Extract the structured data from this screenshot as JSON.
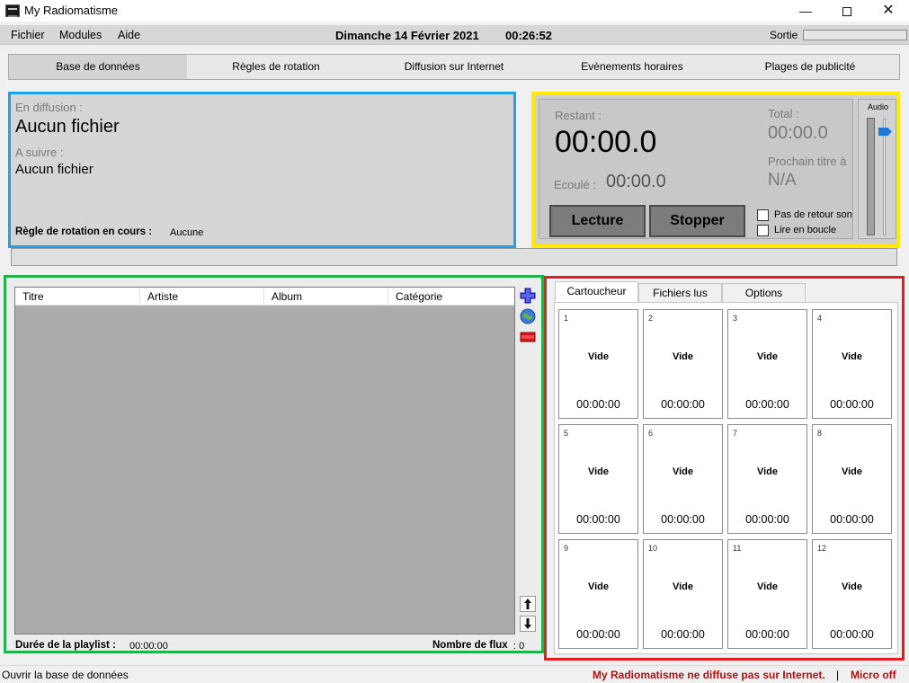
{
  "window": {
    "title": "My Radiomatisme",
    "controls": {
      "minimize": "—",
      "close": "✕"
    }
  },
  "menu": {
    "items": [
      "Fichier",
      "Modules",
      "Aide"
    ],
    "date": "Dimanche 14 Février 2021",
    "time": "00:26:52",
    "sortie_label": "Sortie"
  },
  "tabs": [
    "Base de données",
    "Règles de rotation",
    "Diffusion sur Internet",
    "Evènements horaires",
    "Plages de publicité"
  ],
  "now_playing": {
    "on_air_label": "En diffusion :",
    "on_air_value": "Aucun fichier",
    "next_label": "A suivre :",
    "next_value": "Aucun fichier",
    "rule_label": "Règle de rotation en cours :",
    "rule_value": "Aucune"
  },
  "timer": {
    "remaining_label": "Restant :",
    "remaining_value": "00:00.0",
    "elapsed_label": "Ecoulé :",
    "elapsed_value": "00:00.0",
    "total_label": "Total :",
    "total_value": "00:00.0",
    "next_title_label": "Prochain titre à :",
    "next_title_value": "N/A",
    "play_button": "Lecture",
    "stop_button": "Stopper",
    "no_return_label": "Pas de retour son",
    "loop_label": "Lire en boucle",
    "audio_label": "Audio"
  },
  "playlist": {
    "columns": [
      "Titre",
      "Artiste",
      "Album",
      "Catégorie"
    ],
    "duration_label": "Durée de la playlist :",
    "duration_value": "00:00:00",
    "stream_count_label": "Nombre de flux",
    "stream_count_value": ": 0"
  },
  "cart": {
    "tabs": [
      "Cartoucheur",
      "Fichiers lus",
      "Options"
    ],
    "cells": [
      {
        "num": "1",
        "label": "Vide",
        "time": "00:00:00"
      },
      {
        "num": "2",
        "label": "Vide",
        "time": "00:00:00"
      },
      {
        "num": "3",
        "label": "Vide",
        "time": "00:00:00"
      },
      {
        "num": "4",
        "label": "Vide",
        "time": "00:00:00"
      },
      {
        "num": "5",
        "label": "Vide",
        "time": "00:00:00"
      },
      {
        "num": "6",
        "label": "Vide",
        "time": "00:00:00"
      },
      {
        "num": "7",
        "label": "Vide",
        "time": "00:00:00"
      },
      {
        "num": "8",
        "label": "Vide",
        "time": "00:00:00"
      },
      {
        "num": "9",
        "label": "Vide",
        "time": "00:00:00"
      },
      {
        "num": "10",
        "label": "Vide",
        "time": "00:00:00"
      },
      {
        "num": "11",
        "label": "Vide",
        "time": "00:00:00"
      },
      {
        "num": "12",
        "label": "Vide",
        "time": "00:00:00"
      }
    ]
  },
  "status": {
    "left": "Ouvrir la base de données",
    "internet": "My Radiomatisme ne diffuse pas sur Internet.",
    "separator": "|",
    "mic": "Micro off"
  },
  "colors": {
    "now_playing_border": "#1ea2e2",
    "timer_border": "#ffea00",
    "playlist_border": "#22b14c",
    "cart_border": "#e61c24",
    "status_alert": "#b01010"
  }
}
